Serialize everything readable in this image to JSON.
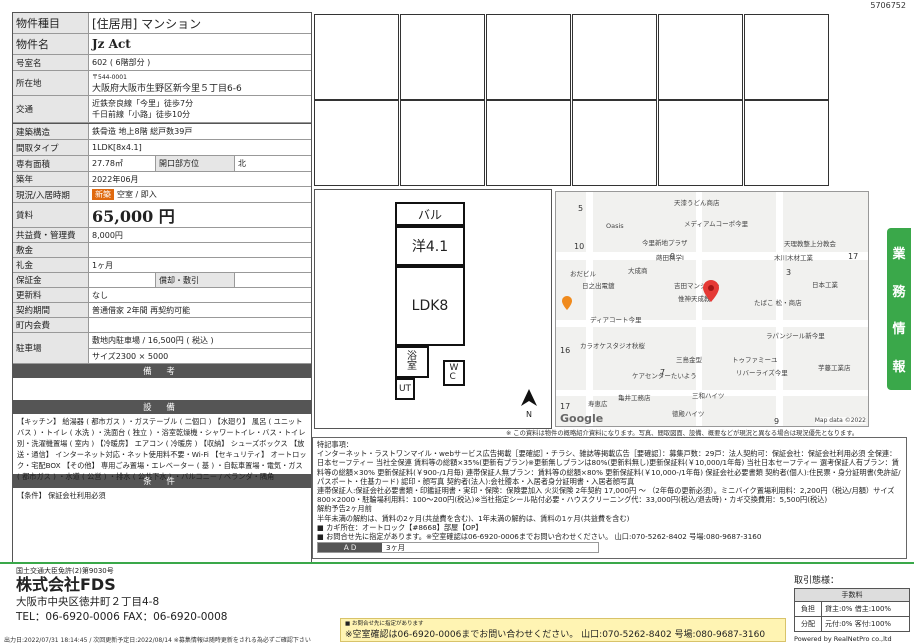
{
  "doc_id": "5706752",
  "rows": {
    "type": {
      "label": "物件種目",
      "value": "[住居用] マンション"
    },
    "name": {
      "label": "物件名",
      "value": "Jz Act"
    },
    "room": {
      "label": "号室名",
      "value": "602 ( 6階部分 )"
    },
    "address": {
      "label": "所在地",
      "zip": "〒544-0001",
      "value": "大阪府大阪市生野区新今里５丁目6-6"
    },
    "transport": {
      "label": "交通",
      "line1": "近鉄奈良線「今里」徒歩7分",
      "line2": "千日前線「小路」徒歩10分"
    },
    "structure": {
      "label": "建築構造",
      "value": "鉄骨造  地上8階  総戸数39戸"
    },
    "layout": {
      "label": "間取タイプ",
      "value": "1LDK[8x4.1]"
    },
    "area": {
      "label": "専有面積",
      "value": "27.78㎡",
      "sub_label": "開口部方位",
      "sub_value": "北"
    },
    "built": {
      "label": "築年",
      "value": "2022年06月"
    },
    "status": {
      "label": "現況/入居時期",
      "badge": "新築",
      "value": "空室 / 即入"
    },
    "rent": {
      "label": "賃料",
      "value": "65,000 円"
    },
    "fee": {
      "label": "共益費・管理費",
      "value": "8,000円"
    },
    "deposit": {
      "label": "敷金",
      "value": ""
    },
    "key_money": {
      "label": "礼金",
      "value": "1ヶ月"
    },
    "guarantee": {
      "label": "保証金",
      "value": "",
      "sub_label": "償却・敷引",
      "sub_value": ""
    },
    "renewal": {
      "label": "更新料",
      "value": "なし"
    },
    "contract": {
      "label": "契約期間",
      "value": "普通借家 2年間 再契約可能"
    },
    "assoc": {
      "label": "町内会費",
      "value": ""
    },
    "parking": {
      "label": "駐車場",
      "value1": "敷地内駐車場 / 16,500円 ( 税込 )",
      "value2": "サイズ2300 × 5000"
    }
  },
  "remarks": {
    "title": "備  考",
    "body": ""
  },
  "equipment": {
    "title": "設  備",
    "body": "【キッチン】 給湯器 ( 都市ガス ) ・ガステーブル ( 二個口 ) 【水廻り】 風呂 ( ユニットバス ) ・トイレ ( 水洗 ) ・洗面台 ( 独立 ) ・浴室乾燥機・シャワートイレ・バス・トイレ別・洗濯機置場 ( 室内 ) 【冷暖房】 エアコン ( 冷暖房 ) 【収納】 シューズボックス 【放送・通信】 インターネット対応・ネット使用料不要・Wi-Fi 【セキュリティ】 オートロック・宅配BOX 【その他】 専用ごみ置場・エレベーター ( 基 ) ・自転車置場・電気・ガス ( 都市ガス ) ・水道 ( 公営 ) ・排水 ( 公共下水 ) ・バルコニー / ベランダ・隅角"
  },
  "conditions": {
    "title": "条  件",
    "body": "【条件】 保証会社利用必須"
  },
  "floorplan": {
    "balcony": "バル",
    "western": "洋4.1",
    "ldk": "LDK8",
    "bath": "浴\n室",
    "toilet": "UT",
    "wc": "W\nC",
    "north": "N"
  },
  "map": {
    "labels": [
      "天漆うどん商店",
      "メディアムコーポ今里",
      "Oasis",
      "今里新地プラザ",
      "蒔田科学I",
      "大成商",
      "天理教整上分教会",
      "木川木材工業",
      "日本工業",
      "おだビル",
      "日之出電鍍",
      "吉田マンション",
      "惟神天成教",
      "たばこ 松・商店",
      "ディアコート今里",
      "ラパンジール新今里",
      "カラオケスタジオ秋桜",
      "三島金型",
      "トゥファミーユ",
      "ケアセンターたいよう",
      "リバーライズ今里",
      "芋蔓工業店",
      "寿恵広",
      "亀井工務店",
      "三和ハイツ",
      "徳殿ハイツ"
    ],
    "numbers": [
      "5",
      "10",
      "9",
      "3",
      "16",
      "17",
      "7",
      "9",
      "17"
    ],
    "google": "Google",
    "credit": "Map data ©2022"
  },
  "disclaimer": "※ この資料は物件の概略紹介資料になります。写真、間取図面、設備、概要などが現況と異なる場合は現況優先となります。",
  "notes": {
    "title": "特記事項：",
    "lines": [
      "インターネット・ラストワンマイル・webサービス広告掲載［要確認］・チラシ、雑誌等掲載広告［要確認］：募集戸数：29戸：法人契約可：保証会社：保証会社利用必須 全保連：日本セーフティー 当社全保連 賃料等の総額×35%(更新有プラン)※更新無しプランは80%(更新料無し)更新保証料(￥10,000/1年毎) 当社日本セーフティー 選考保証人有プラン：賃料等の総額×30% 更新保証料(￥900-/1月毎) 連帯保証人無プラン：賃料等の総額×80% 更新保証料(￥10,000-/1年毎) 保証会社必要書類 契約者(個人):住民票・身分証明書(免許証/パスポート・住基カード) 認印・顔写真 契約者(法人):会社謄本・入居者身分証明書・入居者顔写真",
      "連帯保証人:保証会社必要書類・印鑑証明書・実印・保険：保険要加入 火災保険 2年契約 17,000円 ～ （2年毎の更新必須）。ミニバイク置場利用料：2,200円（税込/月額）サイズ800×2000・駐輪場利用料：100～200円(税込)※当社指定シール貼付必要・ハウスクリーニング代：33,000円(税込/退去時)・カギ交換費用：5,500円(税込)",
      "解約予告2ヶ月前",
      "半年未満の解約は、賃料の2ヶ月(共益費を含む)、1年未満の解約は、賃料の1ヶ月(共益費を含む)",
      "■ カギ所在：オートロック【#8668】部屋【OP】",
      "■ お問合せ先に指定があります。※空室確認は06-6920-0006までお問い合わせください。  山口:070-5262-8402  号場:080-9687-3160"
    ],
    "ad_label": "ＡＤ",
    "ad_value": "3ヶ月"
  },
  "side_tab": [
    "業",
    "務",
    "情",
    "報"
  ],
  "company": {
    "license": "国土交通大臣免許(2)第9030号",
    "name": "株式会社FDS",
    "address": "大阪市中央区徳井町２丁目4-8",
    "phone": "TEL：06-6920-0006   FAX：06-6920-0008"
  },
  "contact_note": {
    "small": "■ お問合せ先に指定があります",
    "main": "※空室確認は06-6920-0006までお問い合わせください。  山口:070-5262-8402  号場:080-9687-3160"
  },
  "footer_left": "出力日:2022/07/31 18:14:45 / 次回更新予定日:2022/08/14 ※募集情報は随時更新をされる為必ずご確認下さい",
  "commission": {
    "title": "取引態様：",
    "head": "手数料",
    "rows": [
      {
        "k": "負担",
        "v": "貸主:0%  借主:100%"
      },
      {
        "k": "分配",
        "v": "元付:0%  客付:100%"
      }
    ]
  },
  "powered": "Powered by RealNetPro co.,ltd"
}
